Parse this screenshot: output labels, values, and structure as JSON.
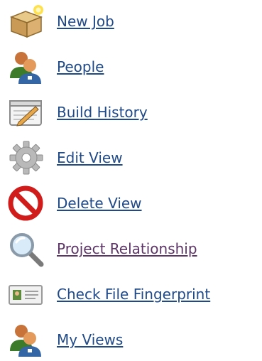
{
  "tasks": [
    {
      "label": "New Job",
      "icon": "new-job-icon"
    },
    {
      "label": "People",
      "icon": "people-icon"
    },
    {
      "label": "Build History",
      "icon": "build-history-icon"
    },
    {
      "label": "Edit View",
      "icon": "gear-icon"
    },
    {
      "label": "Delete View",
      "icon": "no-entry-icon"
    },
    {
      "label": "Project Relationship",
      "icon": "magnifier-icon"
    },
    {
      "label": "Check File Fingerprint",
      "icon": "fingerprint-icon"
    },
    {
      "label": "My Views",
      "icon": "people-icon"
    }
  ],
  "colors": {
    "link": "#204a87",
    "visited_link": "#5c3566"
  }
}
